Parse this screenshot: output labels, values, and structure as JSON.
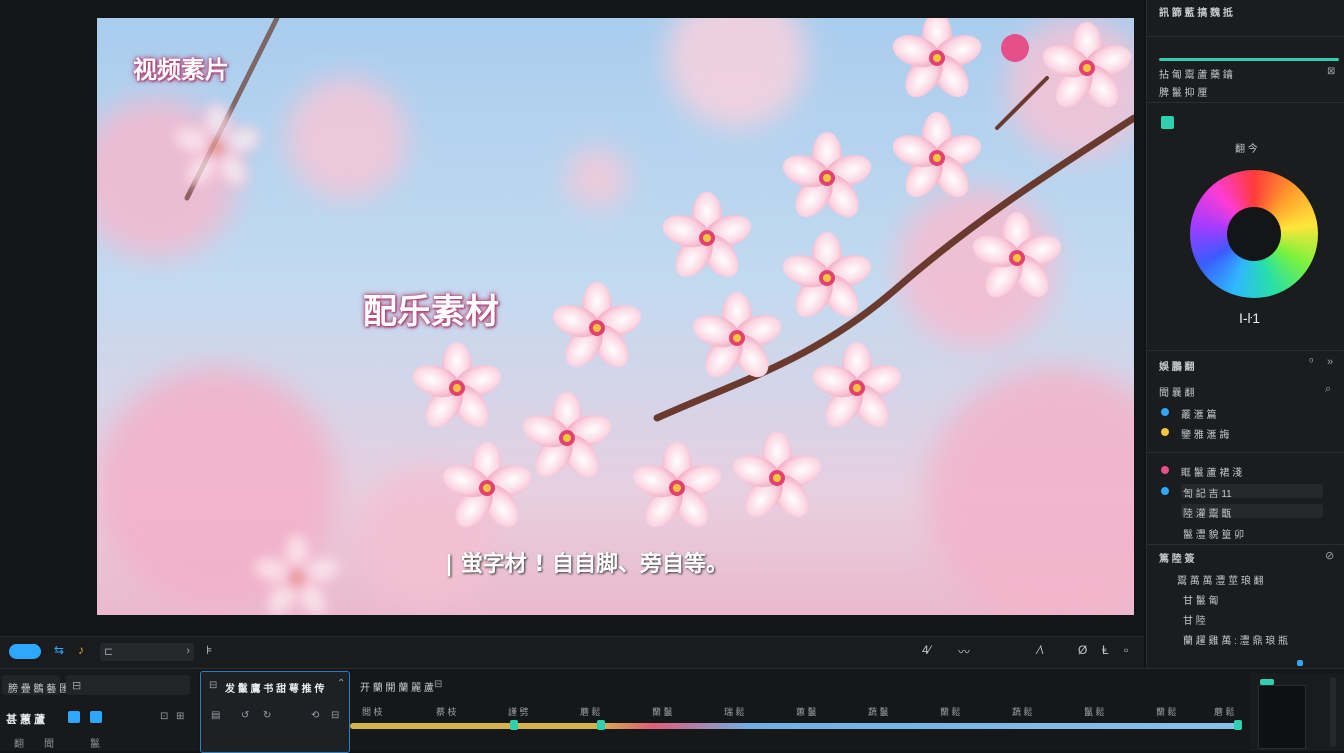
{
  "preview": {
    "title_left": "视频素片",
    "title_center": "配乐素材",
    "subtitle": "| 蛍字材 ! 自自脚、旁自等。"
  },
  "playbar": {
    "play_label": "",
    "timecode": "",
    "right_icons": [
      "4⁄",
      "〰",
      "⁄\\",
      "Ø",
      "Ⱡ",
      "▫"
    ]
  },
  "inspector": {
    "header": "訊 篩 藍 搞 魏 抵",
    "section1": "拈 匍 鬻 蘆 藥 鑰",
    "section1_sub": "脾 鬣 抑 厘",
    "color_label": "翻 今",
    "color_value": "I-ŀ1",
    "panel2_title": "娛 鵬 翻",
    "panel2_search": "聞 曩 翻",
    "rows": [
      "叢 滙 篇",
      "鑒 雅 滙 誨",
      "眶 鬣 蘆 裙 淺",
      "訇 記 吉 11",
      "陸 灌 鬻 甑",
      "鬣 灃 貌 篁 卯"
    ],
    "panel3_title": "篤 陸 簽",
    "panel3_rows": [
      "鬻 萬 萬 灃 莖 琅 翻",
      "甘 鬣 匍",
      "甘 陸",
      "蘭 趯 雞 萬 : 灃 鼎 琅 瓶"
    ],
    "accent_color": "#2ea7ff",
    "teal_color": "#2fd0b0"
  },
  "timeline": {
    "left_tab": "膀 疊 鶵 藝 匯",
    "left_label": "甚 蕙 蘆",
    "left_bottom": [
      "翻",
      "聞",
      "鬣"
    ],
    "center_tab": "发 鬣 鷹 书 甜 萼 推 传",
    "center_tab2": "开 蘭 開 蘭 麗 蘆",
    "tick_labels": [
      "閲 枝",
      "蔡 枝",
      "謹 劈",
      "蘑 鬆",
      "蘭 鬣",
      "瑞 鬆",
      "蕙 鬣",
      "蔬 鬣",
      "蘭 鬆",
      "蔬 鬆",
      "鬣 鬆",
      "蘭 鬆",
      "蘑 鬆"
    ]
  }
}
